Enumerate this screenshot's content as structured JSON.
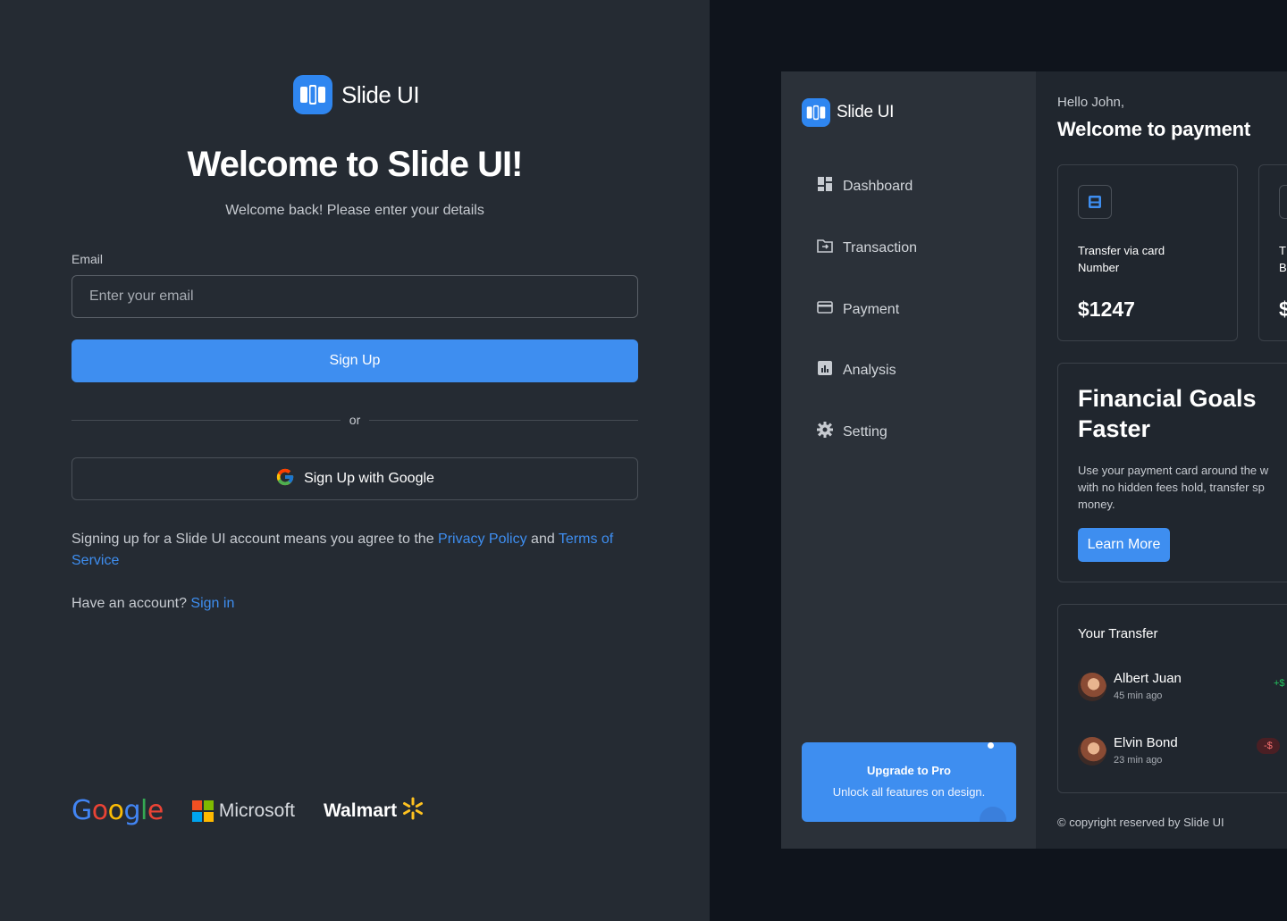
{
  "login": {
    "brand_name": "Slide UI",
    "title": "Welcome to Slide UI!",
    "subtitle": "Welcome back! Please enter your details",
    "email_label": "Email",
    "email_placeholder": "Enter your email",
    "email_value": "",
    "signup_label": "Sign Up",
    "or_label": "or",
    "google_label": "Sign Up with Google",
    "terms_prefix": "Signing up for a Slide UI account means you agree to the ",
    "privacy_link": "Privacy Policy",
    "terms_and": " and ",
    "terms_link": "Terms of Service",
    "have_account": "Have an account? ",
    "signin_link": "Sign in",
    "partner_logos": {
      "google": "Google",
      "microsoft": "Microsoft",
      "walmart": "Walmart"
    }
  },
  "dashboard": {
    "brand_name": "Slide UI",
    "nav": [
      {
        "label": "Dashboard",
        "icon": "dashboard-icon"
      },
      {
        "label": "Transaction",
        "icon": "transaction-icon"
      },
      {
        "label": "Payment",
        "icon": "card-icon"
      },
      {
        "label": "Analysis",
        "icon": "analysis-icon"
      },
      {
        "label": "Setting",
        "icon": "gear-icon"
      }
    ],
    "upgrade": {
      "title": "Upgrade to Pro",
      "subtitle": "Unlock all features on design."
    },
    "greeting": "Hello John,",
    "heading": "Welcome to payment",
    "transfer_card": {
      "label": "Transfer via card Number",
      "value": "$1247"
    },
    "transfer_card_2": {
      "label_line1": "T",
      "label_line2": "B",
      "value": "$"
    },
    "goals": {
      "title_line1": "Financial Goals",
      "title_line2": "Faster",
      "text_line1": "Use your payment card around the w",
      "text_line2": "with no hidden fees hold, transfer sp",
      "text_line3": "money.",
      "button": "Learn More"
    },
    "transfers": {
      "title": "Your Transfer",
      "items": [
        {
          "name": "Albert Juan",
          "time": "45 min ago",
          "amount": "+$",
          "type": "positive"
        },
        {
          "name": "Elvin Bond",
          "time": "23 min ago",
          "amount": "-$",
          "type": "negative"
        }
      ]
    },
    "copyright": "© copyright reserved by Slide UI"
  },
  "colors": {
    "accent": "#3e8ef0",
    "left_bg": "#252b33",
    "dash_bg": "#20262e",
    "sidebar_bg": "#2b3139"
  }
}
